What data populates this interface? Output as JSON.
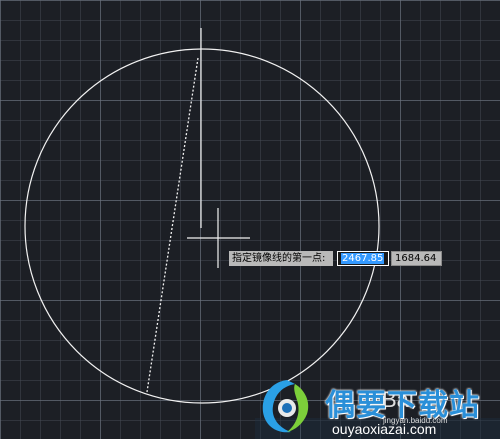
{
  "dynamic_input": {
    "prompt": "指定镜像线的第一点:",
    "x_value": "2467.85",
    "y_value": "1684.64"
  },
  "watermark": {
    "site_name": "偶要下载站",
    "site_url": "ouyaoxiazai.com",
    "baidu_text": "Bai",
    "baidu_sub": "jingyan.baidu.com"
  },
  "colors": {
    "canvas_bg": "#1c1f25",
    "entity": "#ffffff",
    "selection": "#3399ff",
    "prompt_bg": "#b9b9b9"
  },
  "icons": [
    "crosshair-cursor-icon",
    "site-logo-icon"
  ]
}
